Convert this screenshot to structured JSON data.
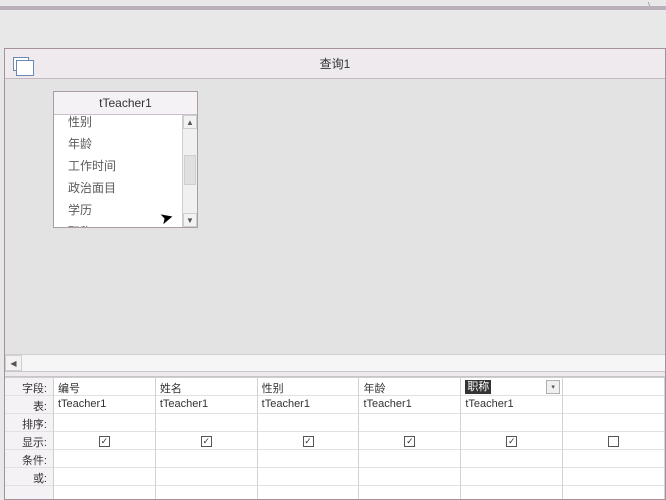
{
  "stray_ui_char": "\\",
  "window": {
    "title": "查询1"
  },
  "tableBox": {
    "title": "tTeacher1",
    "fields": [
      "性别",
      "年龄",
      "工作时间",
      "政治面目",
      "学历",
      "职称"
    ]
  },
  "rowLabels": {
    "field": "字段:",
    "table": "表:",
    "sort": "排序:",
    "show": "显示:",
    "criteria": "条件:",
    "or": "或:"
  },
  "columns": [
    {
      "field": "编号",
      "table": "tTeacher1",
      "show": true
    },
    {
      "field": "姓名",
      "table": "tTeacher1",
      "show": true
    },
    {
      "field": "性别",
      "table": "tTeacher1",
      "show": true
    },
    {
      "field": "年龄",
      "table": "tTeacher1",
      "show": true
    },
    {
      "field": "职称",
      "table": "tTeacher1",
      "show": true,
      "active": true
    }
  ]
}
